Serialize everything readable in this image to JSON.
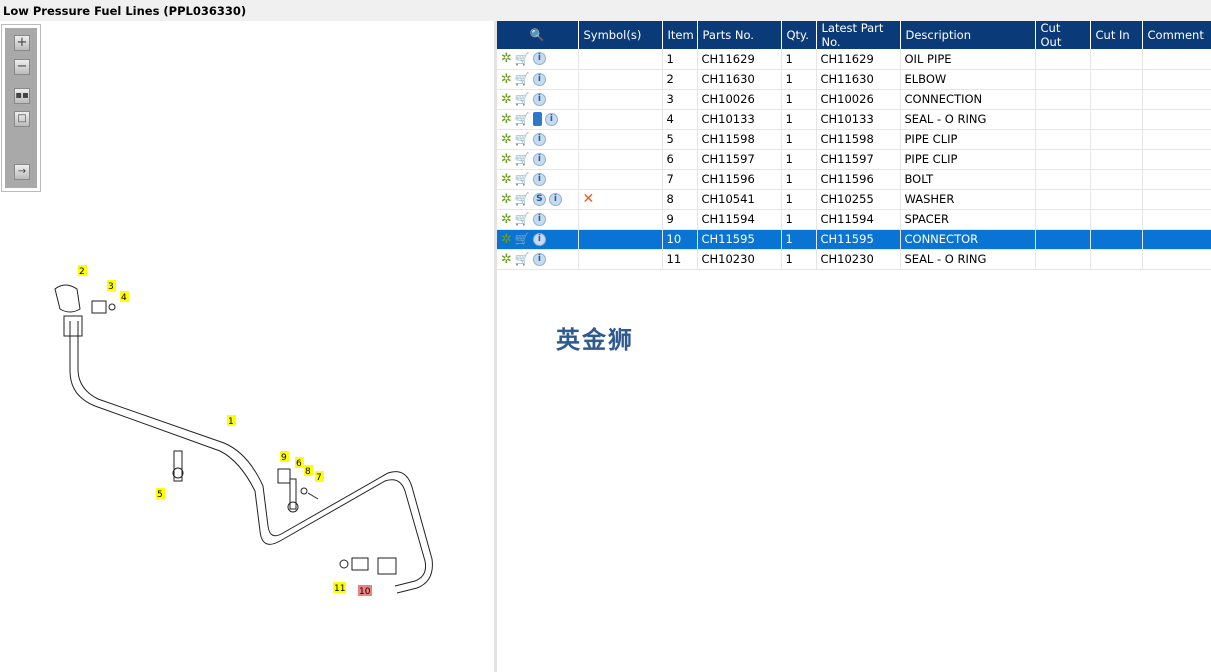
{
  "title": "Low Pressure Fuel Lines (PPL036330)",
  "toolbar": {
    "icons": [
      "zoom-in-icon",
      "zoom-out-icon",
      "fit-all-icon",
      "actual-size-icon",
      "toggle-panel-icon"
    ]
  },
  "table": {
    "headers": {
      "icons": "",
      "symbols": "Symbol(s)",
      "item": "Item",
      "parts_no": "Parts No.",
      "qty": "Qty.",
      "latest": "Latest Part No.",
      "description": "Description",
      "cut_out": "Cut Out",
      "cut_in": "Cut In",
      "comment": "Comment"
    },
    "rows": [
      {
        "item": "1",
        "parts_no": "CH11629",
        "qty": "1",
        "latest": "CH11629",
        "description": "OIL PIPE",
        "extra": ""
      },
      {
        "item": "2",
        "parts_no": "CH11630",
        "qty": "1",
        "latest": "CH11630",
        "description": "ELBOW",
        "extra": ""
      },
      {
        "item": "3",
        "parts_no": "CH10026",
        "qty": "1",
        "latest": "CH10026",
        "description": "CONNECTION",
        "extra": ""
      },
      {
        "item": "4",
        "parts_no": "CH10133",
        "qty": "1",
        "latest": "CH10133",
        "description": "SEAL - O RING",
        "extra": "book"
      },
      {
        "item": "5",
        "parts_no": "CH11598",
        "qty": "1",
        "latest": "CH11598",
        "description": "PIPE CLIP",
        "extra": ""
      },
      {
        "item": "6",
        "parts_no": "CH11597",
        "qty": "1",
        "latest": "CH11597",
        "description": "PIPE CLIP",
        "extra": ""
      },
      {
        "item": "7",
        "parts_no": "CH11596",
        "qty": "1",
        "latest": "CH11596",
        "description": "BOLT",
        "extra": ""
      },
      {
        "item": "8",
        "parts_no": "CH10541",
        "qty": "1",
        "latest": "CH10255",
        "description": "WASHER",
        "extra": "S",
        "symbol": "✕"
      },
      {
        "item": "9",
        "parts_no": "CH11594",
        "qty": "1",
        "latest": "CH11594",
        "description": "SPACER",
        "extra": ""
      },
      {
        "item": "10",
        "parts_no": "CH11595",
        "qty": "1",
        "latest": "CH11595",
        "description": "CONNECTOR",
        "extra": "",
        "selected": true
      },
      {
        "item": "11",
        "parts_no": "CH10230",
        "qty": "1",
        "latest": "CH10230",
        "description": "SEAL - O RING",
        "extra": ""
      }
    ]
  },
  "watermark": "英金狮",
  "diagram": {
    "callouts": [
      "1",
      "2",
      "3",
      "4",
      "5",
      "6",
      "7",
      "8",
      "9",
      "10",
      "11"
    ],
    "highlighted": "10",
    "highlight_color": "#f08080",
    "callout_color": "#ffff00"
  }
}
